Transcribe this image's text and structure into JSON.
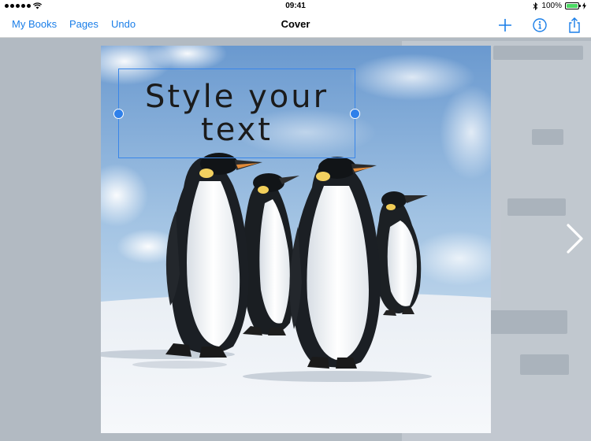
{
  "status_bar": {
    "time": "09:41",
    "battery_percent": "100%",
    "battery_level": 1.0
  },
  "nav_bar": {
    "my_books_label": "My Books",
    "pages_label": "Pages",
    "undo_label": "Undo",
    "title": "Cover",
    "add_icon": "plus-icon",
    "info_icon": "info-icon",
    "share_icon": "share-icon"
  },
  "text_box": {
    "line1": "Style your",
    "line2": "text"
  },
  "colors": {
    "accent": "#1a7ee8",
    "selection": "#3a86e8",
    "battery": "#4cd964"
  }
}
